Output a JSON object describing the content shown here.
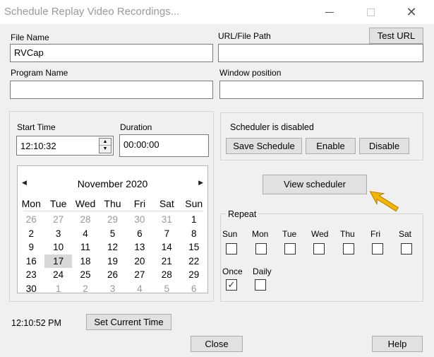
{
  "window": {
    "title": "Schedule Replay Video Recordings...",
    "minimize_icon": "minimize-icon",
    "maximize_icon": "maximize-icon",
    "close_icon": "close-icon",
    "close_glyph": "✕"
  },
  "file": {
    "file_name_label": "File Name",
    "file_name_value": "RVCap",
    "url_label": "URL/File Path",
    "url_value": "",
    "test_url_label": "Test URL",
    "program_name_label": "Program Name",
    "program_name_value": "",
    "window_position_label": "Window position",
    "window_position_value": ""
  },
  "time": {
    "start_time_label": "Start Time",
    "start_time_value": "12:10:32",
    "duration_label": "Duration",
    "duration_value": "00:00:00",
    "spin_up": "▲",
    "spin_down": "▼"
  },
  "calendar": {
    "month_label": "November 2020",
    "prev_glyph": "◀",
    "next_glyph": "▶",
    "weekdays": [
      "Mon",
      "Tue",
      "Wed",
      "Thu",
      "Fri",
      "Sat",
      "Sun"
    ],
    "selected_day": "17",
    "weeks": [
      [
        {
          "d": "26",
          "o": true
        },
        {
          "d": "27",
          "o": true
        },
        {
          "d": "28",
          "o": true
        },
        {
          "d": "29",
          "o": true
        },
        {
          "d": "30",
          "o": true
        },
        {
          "d": "31",
          "o": true
        },
        {
          "d": "1",
          "o": false
        }
      ],
      [
        {
          "d": "2",
          "o": false
        },
        {
          "d": "3",
          "o": false
        },
        {
          "d": "4",
          "o": false
        },
        {
          "d": "5",
          "o": false
        },
        {
          "d": "6",
          "o": false
        },
        {
          "d": "7",
          "o": false
        },
        {
          "d": "8",
          "o": false
        }
      ],
      [
        {
          "d": "9",
          "o": false
        },
        {
          "d": "10",
          "o": false
        },
        {
          "d": "11",
          "o": false
        },
        {
          "d": "12",
          "o": false
        },
        {
          "d": "13",
          "o": false
        },
        {
          "d": "14",
          "o": false
        },
        {
          "d": "15",
          "o": false
        }
      ],
      [
        {
          "d": "16",
          "o": false
        },
        {
          "d": "17",
          "o": false
        },
        {
          "d": "18",
          "o": false
        },
        {
          "d": "19",
          "o": false
        },
        {
          "d": "20",
          "o": false
        },
        {
          "d": "21",
          "o": false
        },
        {
          "d": "22",
          "o": false
        }
      ],
      [
        {
          "d": "23",
          "o": false
        },
        {
          "d": "24",
          "o": false
        },
        {
          "d": "25",
          "o": false
        },
        {
          "d": "26",
          "o": false
        },
        {
          "d": "27",
          "o": false
        },
        {
          "d": "28",
          "o": false
        },
        {
          "d": "29",
          "o": false
        }
      ],
      [
        {
          "d": "30",
          "o": false
        },
        {
          "d": "1",
          "o": true
        },
        {
          "d": "2",
          "o": true
        },
        {
          "d": "3",
          "o": true
        },
        {
          "d": "4",
          "o": true
        },
        {
          "d": "5",
          "o": true
        },
        {
          "d": "6",
          "o": true
        }
      ]
    ]
  },
  "scheduler": {
    "status_text": "Scheduler is disabled",
    "save_label": "Save Schedule",
    "enable_label": "Enable",
    "disable_label": "Disable",
    "view_label": "View scheduler",
    "pointer_icon": "arrow-pointer-icon",
    "pointer_color": "#f5b400"
  },
  "repeat": {
    "group_label": "Repeat",
    "days": [
      {
        "label": "Sun",
        "checked": false
      },
      {
        "label": "Mon",
        "checked": false
      },
      {
        "label": "Tue",
        "checked": false
      },
      {
        "label": "Wed",
        "checked": false
      },
      {
        "label": "Thu",
        "checked": false
      },
      {
        "label": "Fri",
        "checked": false
      },
      {
        "label": "Sat",
        "checked": false
      }
    ],
    "once_label": "Once",
    "once_checked": true,
    "daily_label": "Daily",
    "daily_checked": false,
    "check_glyph": "✓"
  },
  "footer": {
    "current_time": "12:10:52 PM",
    "set_current_time_label": "Set Current Time",
    "close_label": "Close",
    "help_label": "Help"
  }
}
